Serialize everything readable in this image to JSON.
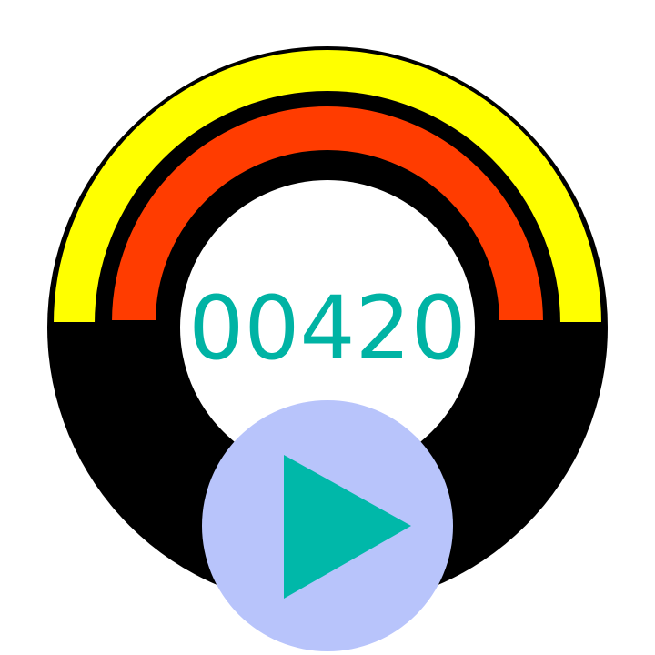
{
  "game": {
    "score": "00420"
  },
  "colors": {
    "outer_band": "#ffff00",
    "inner_band": "#ff3c00",
    "ring": "#000000",
    "outline": "#000000",
    "center": "#ffffff",
    "score_text": "#00b3a4",
    "play_button_bg": "#b8c4fb",
    "play_icon": "#00b8a9"
  },
  "icons": {
    "play": "play-icon"
  }
}
